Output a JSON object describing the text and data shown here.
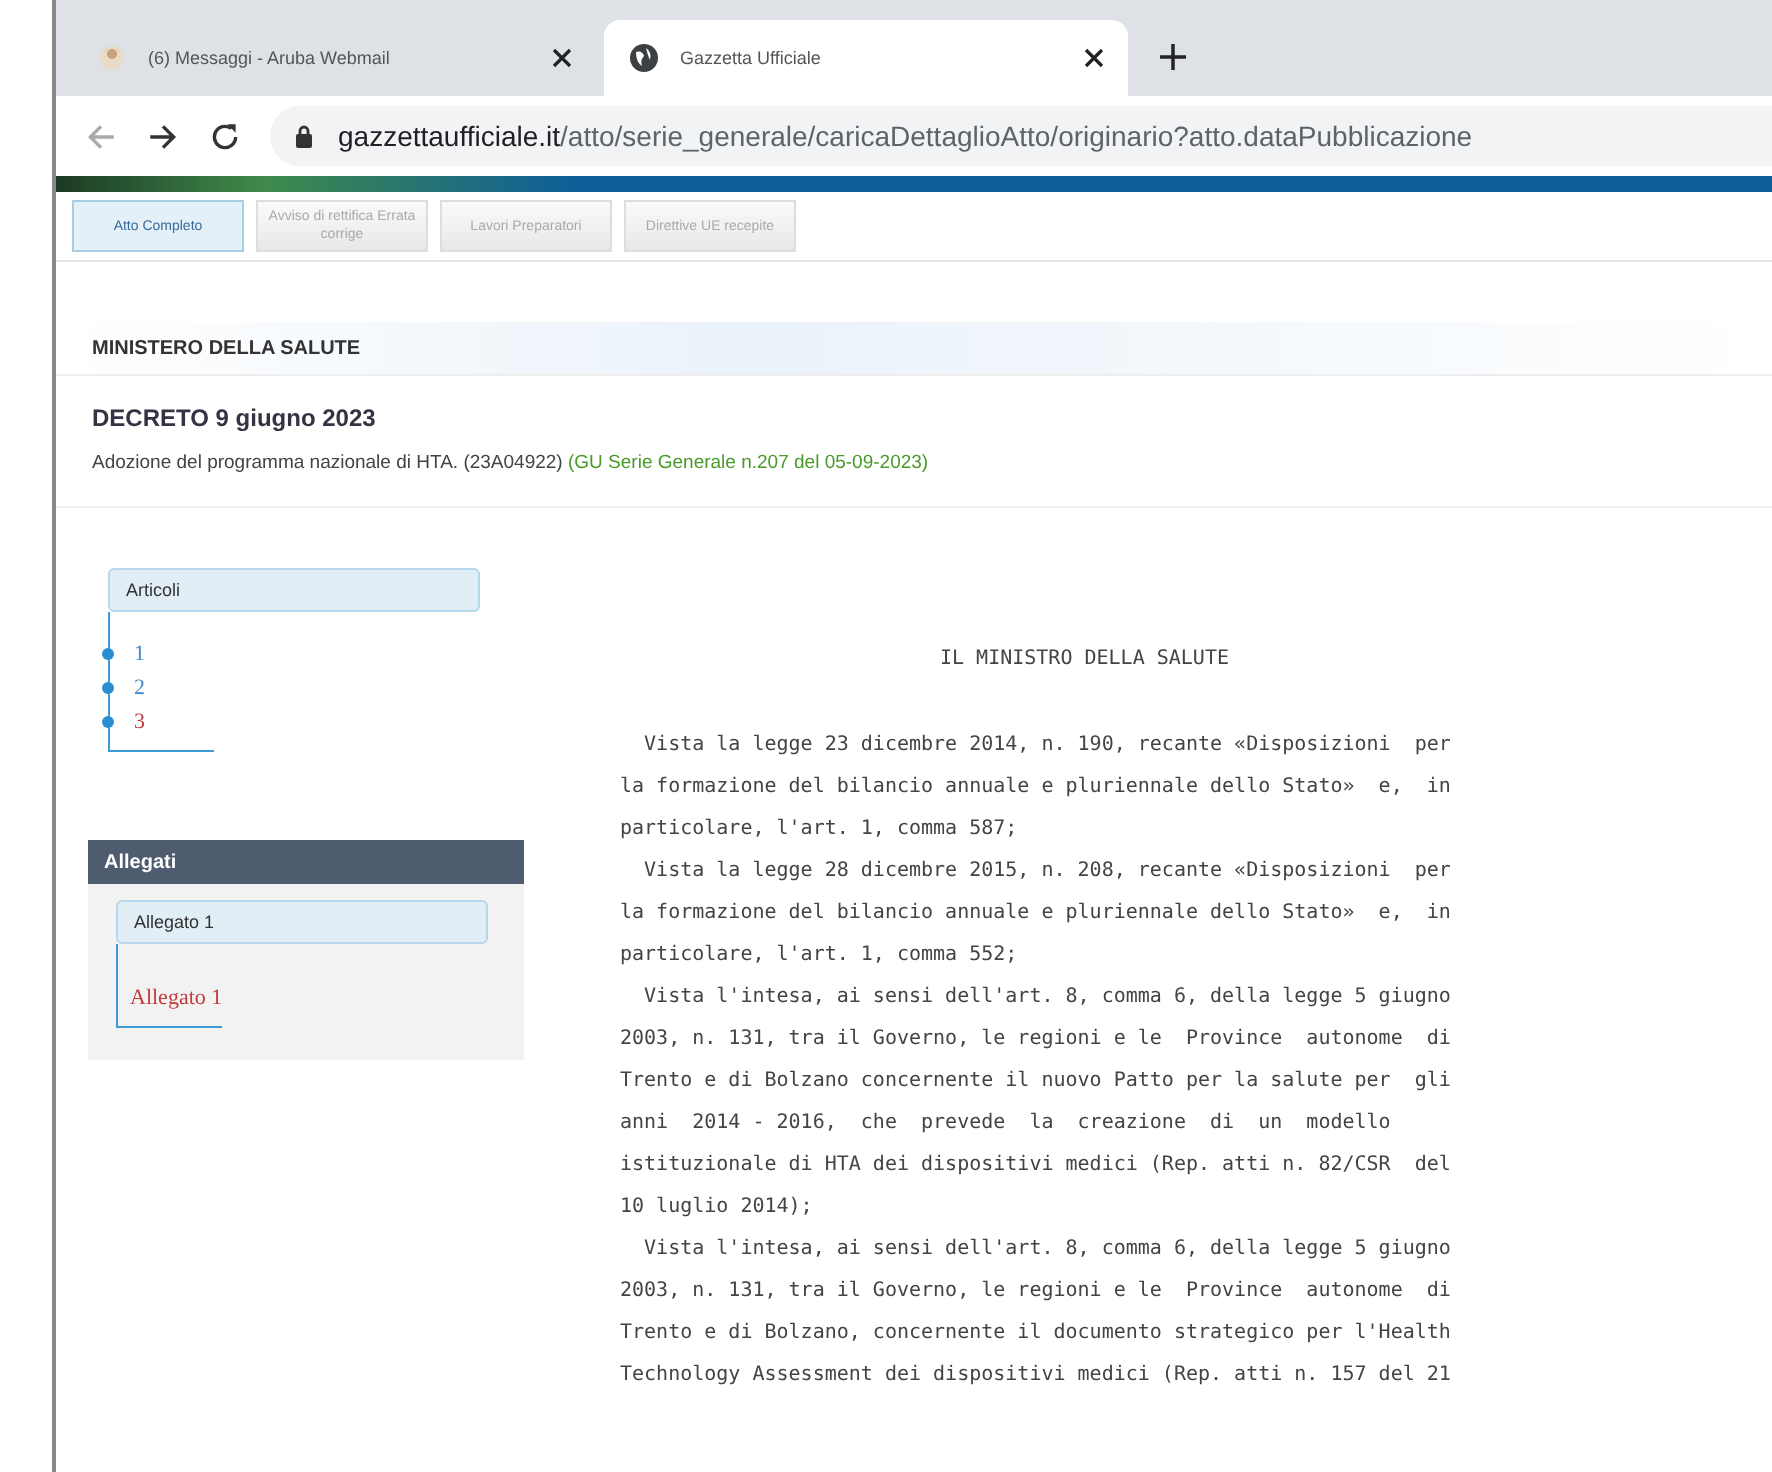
{
  "browser": {
    "tabs": [
      {
        "title": "(6) Messaggi - Aruba Webmail",
        "selected": false
      },
      {
        "title": "Gazzetta Ufficiale",
        "selected": true
      }
    ],
    "url_host": "gazzettaufficiale.it",
    "url_path": "/atto/serie_generale/caricaDettaglioAtto/originario?atto.dataPubblicazione"
  },
  "toolbar": [
    {
      "label": "Atto Completo",
      "selected": true
    },
    {
      "label": "Avviso di rettifica Errata corrige",
      "selected": false
    },
    {
      "label": "Lavori Preparatori",
      "selected": false
    },
    {
      "label": "Direttive UE recepite",
      "selected": false
    }
  ],
  "ministry": "MINISTERO DELLA SALUTE",
  "decree_title": "DECRETO 9 giugno 2023",
  "description": "Adozione del programma nazionale di HTA. (23A04922)",
  "gazette_ref": "(GU Serie Generale n.207 del 05-09-2023)",
  "articles": {
    "title": "Articoli",
    "items": [
      {
        "label": "1",
        "selected": false
      },
      {
        "label": "2",
        "selected": false
      },
      {
        "label": "3",
        "selected": true
      }
    ]
  },
  "attachments": {
    "header": "Allegati",
    "group": "Allegato 1",
    "items": [
      {
        "label": "Allegato 1",
        "selected": true
      }
    ]
  },
  "body": {
    "heading": "IL MINISTRO DELLA SALUTE",
    "lines": [
      "  Vista la legge 23 dicembre 2014, n. 190, recante «Disposizioni  per",
      "la formazione del bilancio annuale e pluriennale dello Stato»  e,  in",
      "particolare, l'art. 1, comma 587;",
      "  Vista la legge 28 dicembre 2015, n. 208, recante «Disposizioni  per",
      "la formazione del bilancio annuale e pluriennale dello Stato»  e,  in",
      "particolare, l'art. 1, comma 552;",
      "  Vista l'intesa, ai sensi dell'art. 8, comma 6, della legge 5 giugno",
      "2003, n. 131, tra il Governo, le regioni e le  Province  autonome  di",
      "Trento e di Bolzano concernente il nuovo Patto per la salute per  gli",
      "anni  2014 - 2016,  che  prevede  la  creazione  di  un  modello",
      "istituzionale di HTA dei dispositivi medici (Rep. atti n. 82/CSR  del",
      "10 luglio 2014);",
      "  Vista l'intesa, ai sensi dell'art. 8, comma 6, della legge 5 giugno",
      "2003, n. 131, tra il Governo, le regioni e le  Province  autonome  di",
      "Trento e di Bolzano, concernente il documento strategico per l'Health",
      "Technology Assessment dei dispositivi medici (Rep. atti n. 157 del 21"
    ]
  }
}
